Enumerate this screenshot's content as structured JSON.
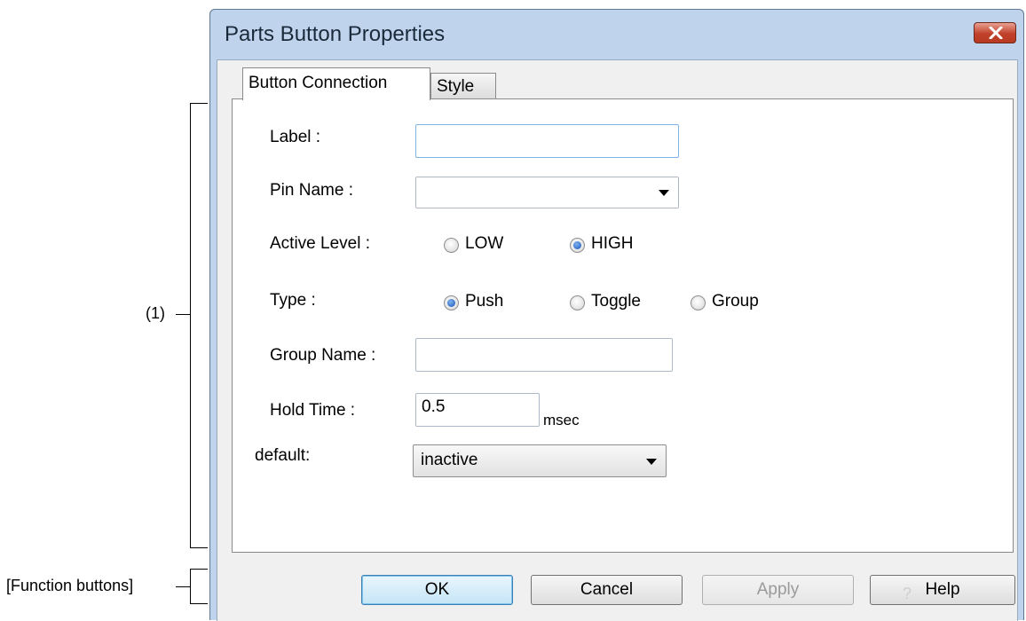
{
  "window": {
    "title": "Parts Button Properties"
  },
  "tabs": [
    {
      "label": "Button Connection"
    },
    {
      "label": "Style"
    }
  ],
  "form": {
    "label": {
      "label": "Label :",
      "value": ""
    },
    "pin_name": {
      "label": "Pin Name :",
      "value": ""
    },
    "active_level": {
      "label": "Active Level :",
      "options": [
        "LOW",
        "HIGH"
      ],
      "selected": "HIGH"
    },
    "type": {
      "label": "Type :",
      "options": [
        "Push",
        "Toggle",
        "Group"
      ],
      "selected": "Push"
    },
    "group_name": {
      "label": "Group Name :",
      "value": ""
    },
    "hold_time": {
      "label": "Hold Time :",
      "value": "0.5",
      "unit": "msec"
    },
    "default": {
      "label": "default:",
      "value": "inactive"
    }
  },
  "buttons": {
    "ok": "OK",
    "cancel": "Cancel",
    "apply": "Apply",
    "help": "Help",
    "help_icon": "?"
  },
  "annotations": {
    "section1": "(1)",
    "function_buttons": "[Function buttons]"
  },
  "icons": {
    "close": "close-icon",
    "dropdown": "chevron-down-icon"
  },
  "colors": {
    "title_bar": "#bfd4ec",
    "close_button": "#c0412b",
    "radio_selected": "#1751b8",
    "ok_button_border": "#3c7fb1"
  }
}
